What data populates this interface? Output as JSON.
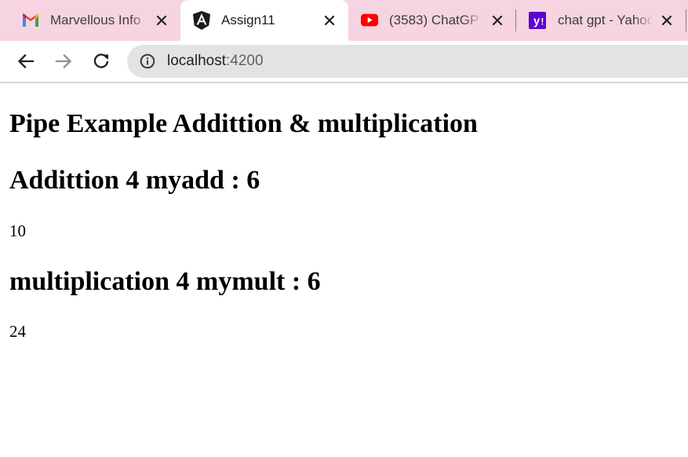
{
  "browser": {
    "tabs": [
      {
        "title": "Marvellous Info",
        "icon": "gmail-icon",
        "active": false
      },
      {
        "title": "Assign11",
        "icon": "angular-icon",
        "active": true
      },
      {
        "title": "(3583) ChatGPT",
        "icon": "youtube-icon",
        "active": false
      },
      {
        "title": "chat gpt - Yahoo",
        "icon": "yahoo-icon",
        "active": false
      }
    ],
    "address": {
      "host": "localhost",
      "port": ":4200"
    }
  },
  "page": {
    "title": "Pipe Example Addittion & multiplication",
    "addition": {
      "heading": "Addittion 4 myadd : 6",
      "result": "10"
    },
    "multiplication": {
      "heading": "multiplication 4 mymult : 6",
      "result": "24"
    }
  },
  "colors": {
    "tabstrip": "#f6d4e1",
    "omnibox": "#e3e3e3",
    "gmail_red": "#ea4335",
    "youtube_red": "#ff0000",
    "yahoo_purple": "#6001d2",
    "angular": "#1a1a1a"
  }
}
